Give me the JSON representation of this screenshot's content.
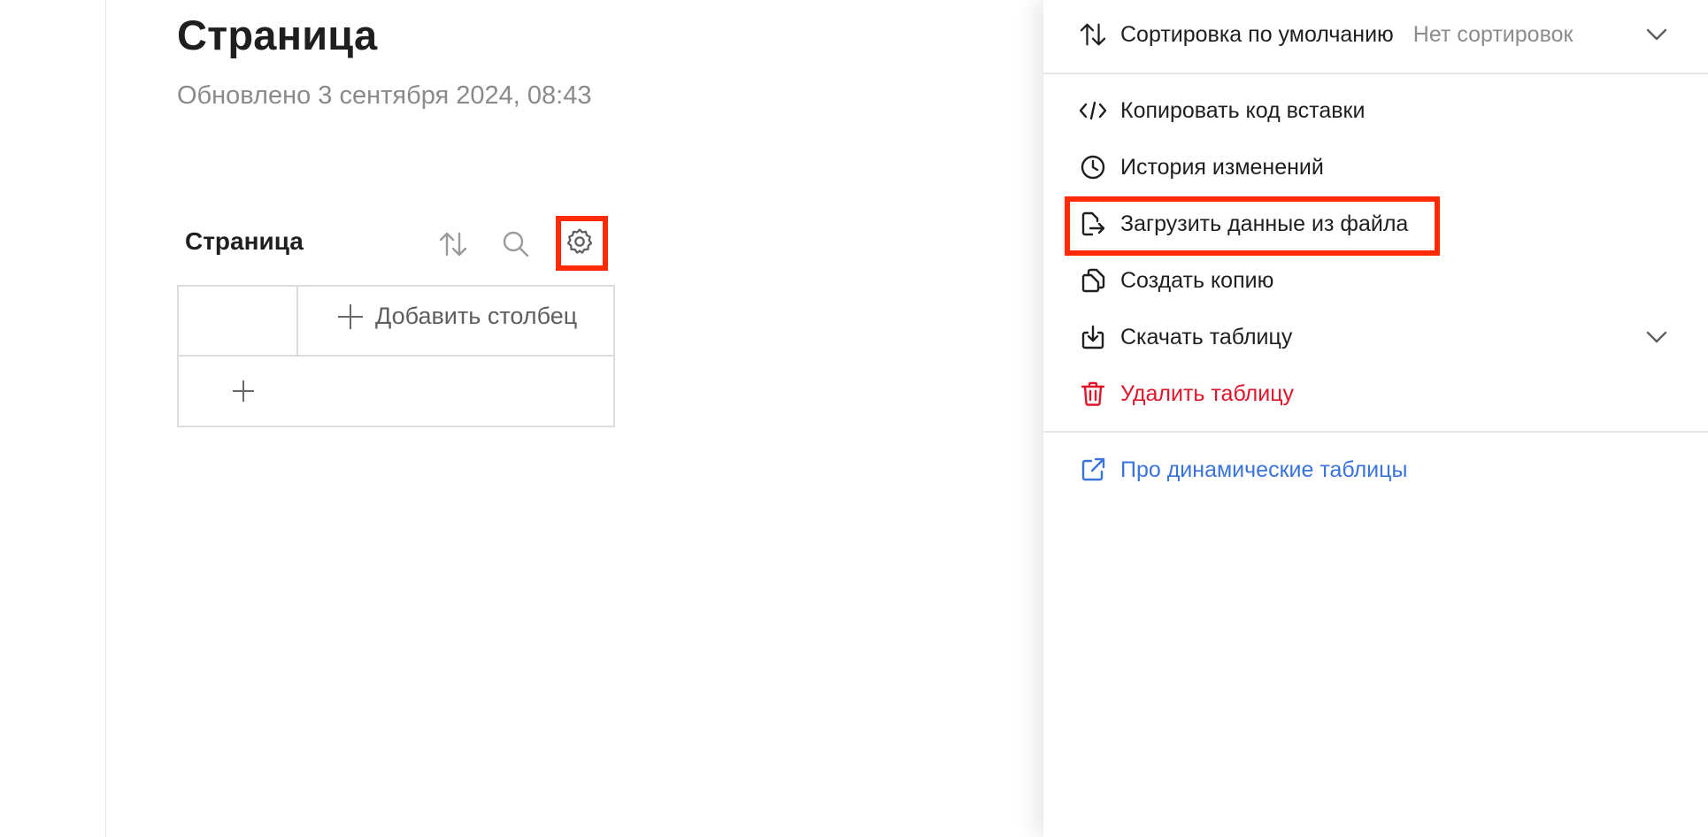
{
  "page": {
    "title": "Страница",
    "updated": "Обновлено 3 сентября 2024, 08:43"
  },
  "table": {
    "title": "Страница",
    "add_column_label": "Добавить столбец",
    "icons": [
      "sort-icon",
      "search-icon",
      "gear-icon",
      "plus-icon"
    ]
  },
  "settings_panel": {
    "sort": {
      "label": "Сортировка по умолчанию",
      "value": "Нет сортировок"
    },
    "items": [
      {
        "label": "Копировать код вставки",
        "icon": "code-icon"
      },
      {
        "label": "История изменений",
        "icon": "clock-icon"
      },
      {
        "label": "Загрузить данные из файла",
        "icon": "upload-file-icon"
      },
      {
        "label": "Создать копию",
        "icon": "copy-icon"
      },
      {
        "label": "Скачать таблицу",
        "icon": "download-icon"
      },
      {
        "label": "Удалить таблицу",
        "icon": "trash-icon"
      }
    ],
    "link": {
      "label": "Про динамические таблицы",
      "icon": "external-link-icon"
    }
  },
  "colors": {
    "highlight": "#ff2a00",
    "danger": "#e0152a",
    "link": "#3a73db",
    "muted": "#8c8c8c"
  }
}
